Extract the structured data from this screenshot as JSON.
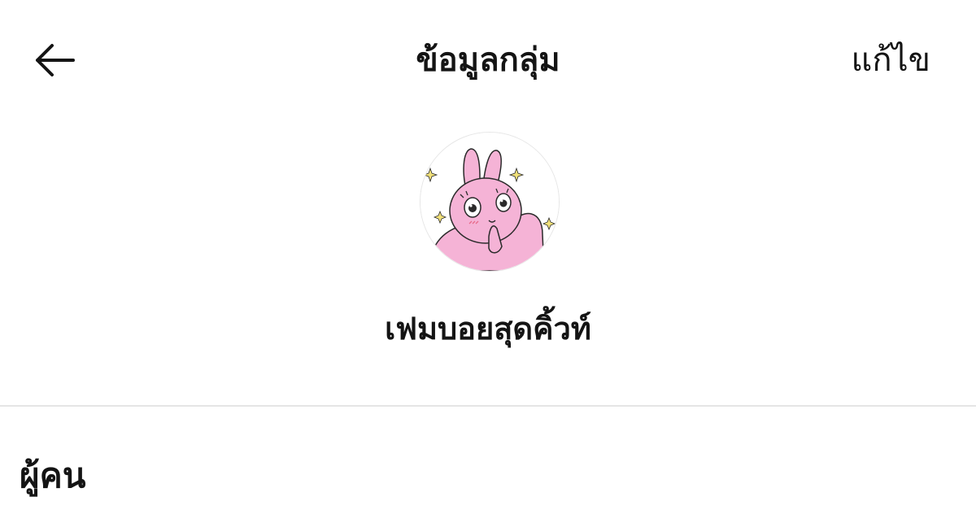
{
  "header": {
    "back_icon": "arrow-left-icon",
    "title": "ข้อมูลกลุ่ม",
    "edit_label": "แก้ไข"
  },
  "group": {
    "avatar_icon": "pink-rabbit-avatar",
    "name": "เฟมบอยสุดคิ้วท์"
  },
  "members_section": {
    "title": "ผู้คน"
  },
  "colors": {
    "text": "#141414",
    "divider": "#e5e5e5",
    "avatar_pink": "#f5b3d6"
  }
}
